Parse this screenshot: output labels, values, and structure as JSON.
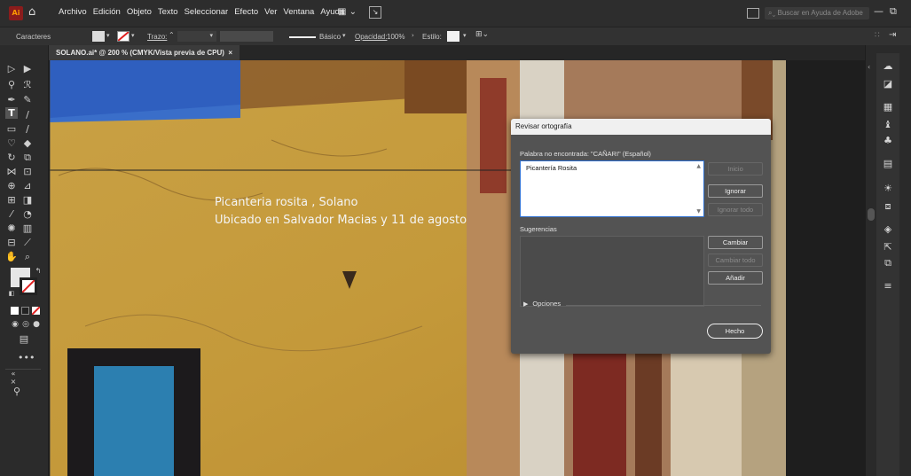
{
  "menubar": {
    "logo": "Ai",
    "menus": [
      "Archivo",
      "Edición",
      "Objeto",
      "Texto",
      "Seleccionar",
      "Efecto",
      "Ver",
      "Ventana",
      "Ayuda"
    ],
    "search_placeholder": "Buscar en Ayuda de Adobe"
  },
  "controlbar": {
    "label": "Caracteres",
    "stroke_label": "Trazo:",
    "brush_label": "Básico",
    "opacity_label": "Opacidad:",
    "opacity_value": "100%",
    "style_label": "Estilo:"
  },
  "document": {
    "tab_title": "SOLANO.ai* @ 200 % (CMYK/Vista previa de CPU)",
    "text_line1": "Picanteria rosita , Solano",
    "text_line2": "Ubicado en Salvador Macias y 11 de agosto"
  },
  "dialog": {
    "title": "Revisar ortografía",
    "not_found_label": "Palabra no encontrada: \"CAÑARI\" (Español)",
    "word_text": "Picantería Rosita",
    "suggestions_label": "Sugerencias",
    "options_label": "Opciones",
    "buttons": {
      "start": "Inicio",
      "ignore": "Ignorar",
      "ignore_all": "Ignorar todo",
      "change": "Cambiar",
      "change_all": "Cambiar todo",
      "add": "Añadir",
      "done": "Hecho"
    }
  },
  "colors": {
    "accent": "#2d6fd0",
    "wall": "#c59a3d",
    "awning": "#2f5fbf"
  }
}
